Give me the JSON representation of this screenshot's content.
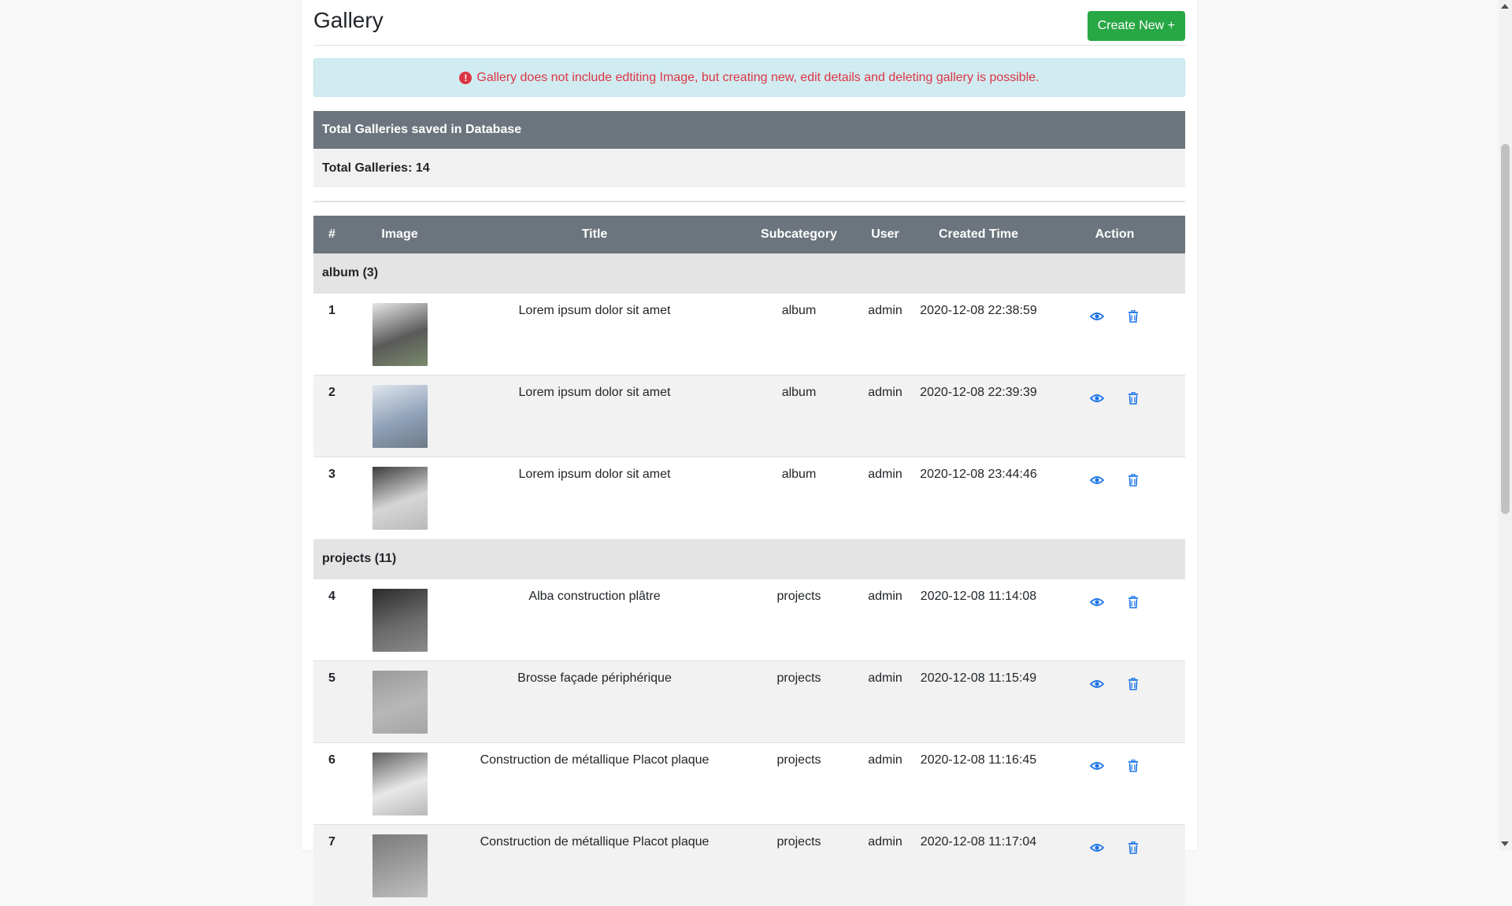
{
  "header": {
    "title": "Gallery",
    "create_label": "Create New +"
  },
  "alert": {
    "text": "Gallery does not include edtiting Image, but creating new, edit details and deleting gallery is possible.",
    "color": "#dc3545"
  },
  "summary": {
    "heading": "Total Galleries saved in Database",
    "total_label": "Total Galleries: 14"
  },
  "table": {
    "columns": [
      "#",
      "Image",
      "Title",
      "Subcategory",
      "User",
      "Created Time",
      "Action"
    ],
    "groups": [
      {
        "label": "album (3)"
      },
      {
        "label": "projects (11)"
      }
    ],
    "rows": [
      {
        "num": "1",
        "title": "Lorem ipsum dolor sit amet",
        "subcategory": "album",
        "user": "admin",
        "created": "2020-12-08 22:38:59"
      },
      {
        "num": "2",
        "title": "Lorem ipsum dolor sit amet",
        "subcategory": "album",
        "user": "admin",
        "created": "2020-12-08 22:39:39"
      },
      {
        "num": "3",
        "title": "Lorem ipsum dolor sit amet",
        "subcategory": "album",
        "user": "admin",
        "created": "2020-12-08 23:44:46"
      },
      {
        "num": "4",
        "title": "Alba construction plâtre",
        "subcategory": "projects",
        "user": "admin",
        "created": "2020-12-08 11:14:08"
      },
      {
        "num": "5",
        "title": "Brosse façade périphérique",
        "subcategory": "projects",
        "user": "admin",
        "created": "2020-12-08 11:15:49"
      },
      {
        "num": "6",
        "title": "Construction de métallique Placot plaque",
        "subcategory": "projects",
        "user": "admin",
        "created": "2020-12-08 11:16:45"
      },
      {
        "num": "7",
        "title": "Construction de métallique Placot plaque",
        "subcategory": "projects",
        "user": "admin",
        "created": "2020-12-08 11:17:04"
      }
    ]
  },
  "icons": {
    "view": "eye-icon",
    "delete": "trash-icon",
    "alert": "exclamation-circle-icon"
  },
  "colors": {
    "accent": "#28a745",
    "header_bg": "#6c757d",
    "icon": "#1a73e8"
  }
}
